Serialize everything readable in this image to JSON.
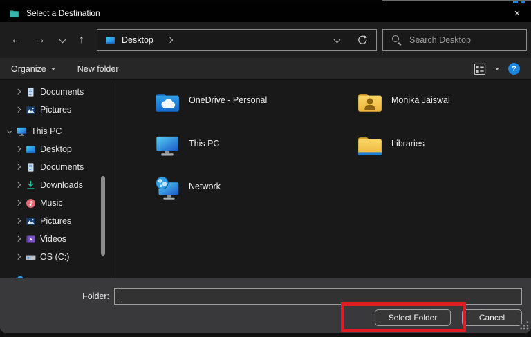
{
  "window": {
    "title": "Select a Destination",
    "close_glyph": "×"
  },
  "nav": {
    "back_glyph": "←",
    "forward_glyph": "→",
    "up_glyph": "↑",
    "address": {
      "location": "Desktop"
    },
    "search_placeholder": "Search Desktop"
  },
  "toolbar": {
    "organize_label": "Organize",
    "new_folder_label": "New folder",
    "help_glyph": "?"
  },
  "sidebar": {
    "items": [
      {
        "label": "Documents",
        "icon": "document",
        "level": 2
      },
      {
        "label": "Pictures",
        "icon": "pictures",
        "level": 2
      },
      {
        "label": "This PC",
        "icon": "monitor",
        "level": 1,
        "expanded": true,
        "group_gap": true
      },
      {
        "label": "Desktop",
        "icon": "desktop",
        "level": 2
      },
      {
        "label": "Documents",
        "icon": "document",
        "level": 2
      },
      {
        "label": "Downloads",
        "icon": "downloads",
        "level": 2
      },
      {
        "label": "Music",
        "icon": "music",
        "level": 2
      },
      {
        "label": "Pictures",
        "icon": "pictures",
        "level": 2
      },
      {
        "label": "Videos",
        "icon": "videos",
        "level": 2
      },
      {
        "label": "OS (C:)",
        "icon": "drive",
        "level": 2
      }
    ]
  },
  "main": {
    "items": [
      {
        "label": "OneDrive - Personal",
        "icon": "folder-onedrive"
      },
      {
        "label": "Monika Jaiswal",
        "icon": "folder-user"
      },
      {
        "label": "This PC",
        "icon": "monitor"
      },
      {
        "label": "Libraries",
        "icon": "folder-libraries"
      },
      {
        "label": "Network",
        "icon": "network"
      }
    ]
  },
  "footer": {
    "folder_label": "Folder:",
    "folder_value": "",
    "select_label": "Select Folder",
    "cancel_label": "Cancel"
  },
  "colors": {
    "annotation_red": "#e01b22",
    "help_blue": "#1a86e0",
    "folder_yellow": "#f3c94e",
    "onedrive_blue": "#2f9fe8"
  }
}
